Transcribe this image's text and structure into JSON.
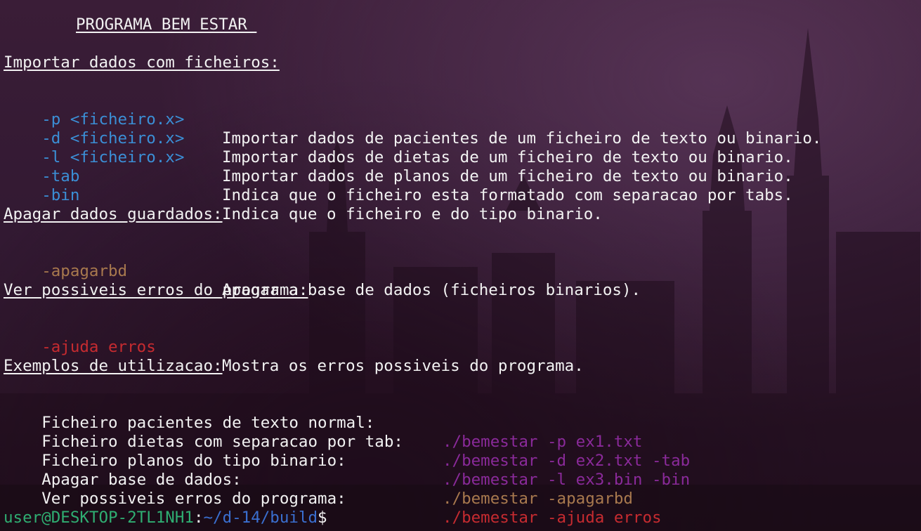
{
  "title": "PROGRAMA BEM ESTAR ",
  "sections": {
    "import": {
      "heading": "Importar dados com ficheiros:",
      "items": [
        {
          "flag": "-p <ficheiro.x>",
          "desc": "Importar dados de pacientes de um ficheiro de texto ou binario."
        },
        {
          "flag": "-d <ficheiro.x>",
          "desc": "Importar dados de dietas de um ficheiro de texto ou binario."
        },
        {
          "flag": "-l <ficheiro.x>",
          "desc": "Importar dados de planos de um ficheiro de texto ou binario."
        },
        {
          "flag": "-tab",
          "desc": "Indica que o ficheiro esta formatado com separacao por tabs."
        },
        {
          "flag": "-bin",
          "desc": "Indica que o ficheiro e do tipo binario."
        }
      ]
    },
    "delete": {
      "heading": "Apagar dados guardados:",
      "flag": "-apagarbd",
      "desc": "Apagar a base de dados (ficheiros binarios)."
    },
    "errors": {
      "heading": "Ver possiveis erros do programa:",
      "flag": "-ajuda erros",
      "desc": "Mostra os erros possiveis do programa."
    },
    "examples": {
      "heading": "Exemplos de utilizacao:",
      "items": [
        {
          "label": "Ficheiro pacientes de texto normal:",
          "command": "./bemestar -p ex1.txt"
        },
        {
          "label": "Ficheiro dietas com separacao por tab:",
          "command": "./bemestar -d ex2.txt -tab"
        },
        {
          "label": "Ficheiro planos do tipo binario:",
          "command": "./bemestar -l ex3.bin -bin"
        },
        {
          "label": "Apagar base de dados:",
          "command": "./bemestar -apagarbd"
        },
        {
          "label": "Ver possiveis erros do programa:",
          "command": "./bemestar -ajuda erros"
        }
      ]
    }
  },
  "prompt": {
    "user_host": "user@DESKTOP-2TL1NH1",
    "separator": ":",
    "path": "~/d-14/build",
    "symbol": "$"
  },
  "colors": {
    "flag_import": "#3b8fd6",
    "flag_delete": "#a8794e",
    "flag_errors": "#c62b30",
    "command_default": "#8a2a9a",
    "prompt_user": "#2fae72",
    "prompt_path": "#3a6fd0",
    "text": "#f2f2f2",
    "background": "#321932"
  }
}
